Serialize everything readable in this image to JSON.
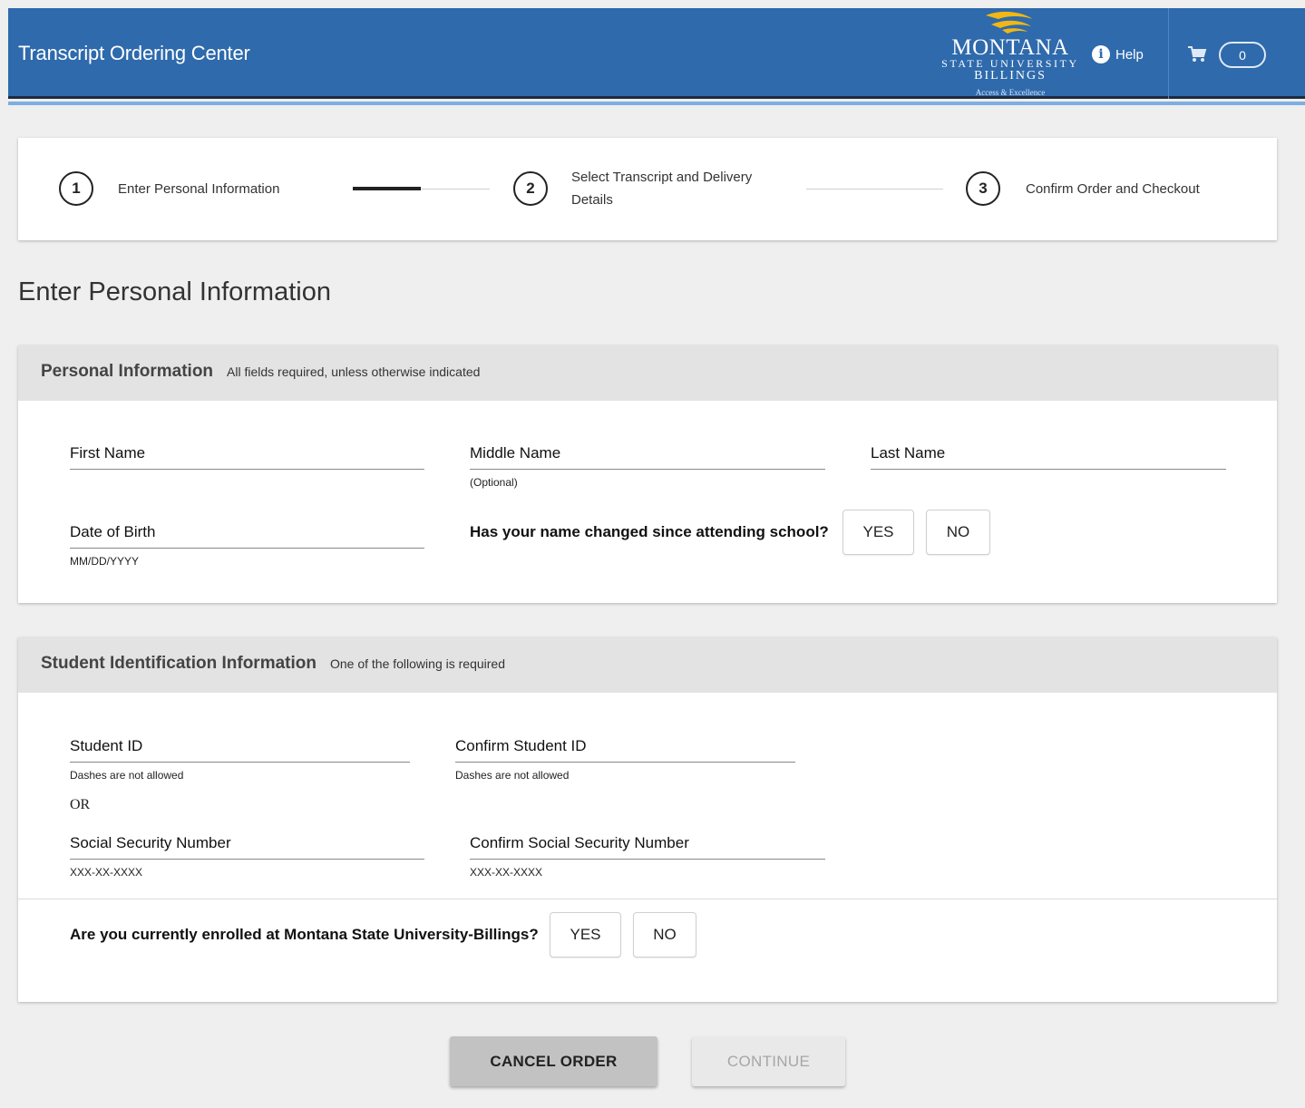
{
  "header": {
    "title": "Transcript Ordering Center",
    "logo": {
      "main": "MONTANA",
      "line2": "STATE UNIVERSITY",
      "line3": "BILLINGS",
      "tagline": "Access & Excellence",
      "icon": "mustang-swoosh-logo"
    },
    "help_label": "Help",
    "help_icon": "info-icon",
    "cart_icon": "shopping-cart-icon",
    "cart_count": "0",
    "colors": {
      "bar": "#2e6aac",
      "logo_gold": "#f2b713"
    }
  },
  "stepper": {
    "steps": [
      {
        "number": "1",
        "label": "Enter Personal Information"
      },
      {
        "number": "2",
        "label": "Select Transcript and Delivery Details"
      },
      {
        "number": "3",
        "label": "Confirm Order and Checkout"
      }
    ],
    "current_step": 1
  },
  "page_title": "Enter Personal Information",
  "personal": {
    "title": "Personal Information",
    "note": "All fields required, unless otherwise indicated",
    "first_name": {
      "label": "First Name",
      "value": ""
    },
    "middle_name": {
      "label": "Middle Name",
      "hint": "(Optional)",
      "value": ""
    },
    "last_name": {
      "label": "Last Name",
      "value": ""
    },
    "dob": {
      "label": "Date of Birth",
      "hint": "MM/DD/YYYY",
      "value": ""
    },
    "name_changed": {
      "question": "Has your name changed since attending school?",
      "yes": "YES",
      "no": "NO"
    }
  },
  "student_id": {
    "title": "Student Identification Information",
    "note": "One of the following is required",
    "student_id": {
      "label": "Student ID",
      "hint": "Dashes are not allowed",
      "value": ""
    },
    "confirm_student_id": {
      "label": "Confirm Student ID",
      "hint": "Dashes are not allowed",
      "value": ""
    },
    "or_text": "OR",
    "ssn": {
      "label": "Social Security Number",
      "hint": "XXX-XX-XXXX",
      "value": ""
    },
    "confirm_ssn": {
      "label": "Confirm Social Security Number",
      "hint": "XXX-XX-XXXX",
      "value": ""
    },
    "enrolled": {
      "question": "Are you currently enrolled at Montana State University-Billings?",
      "yes": "YES",
      "no": "NO"
    }
  },
  "footer": {
    "cancel_label": "CANCEL ORDER",
    "continue_label": "CONTINUE"
  }
}
